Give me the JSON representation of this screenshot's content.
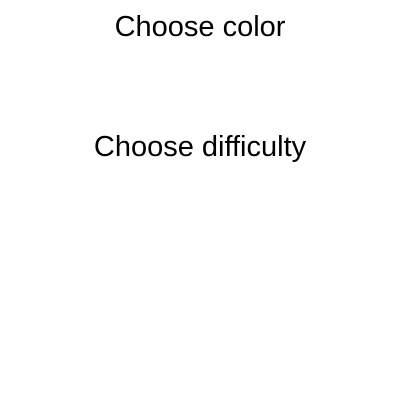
{
  "color_section": {
    "heading": "Choose color"
  },
  "difficulty_section": {
    "heading": "Choose difficulty"
  }
}
